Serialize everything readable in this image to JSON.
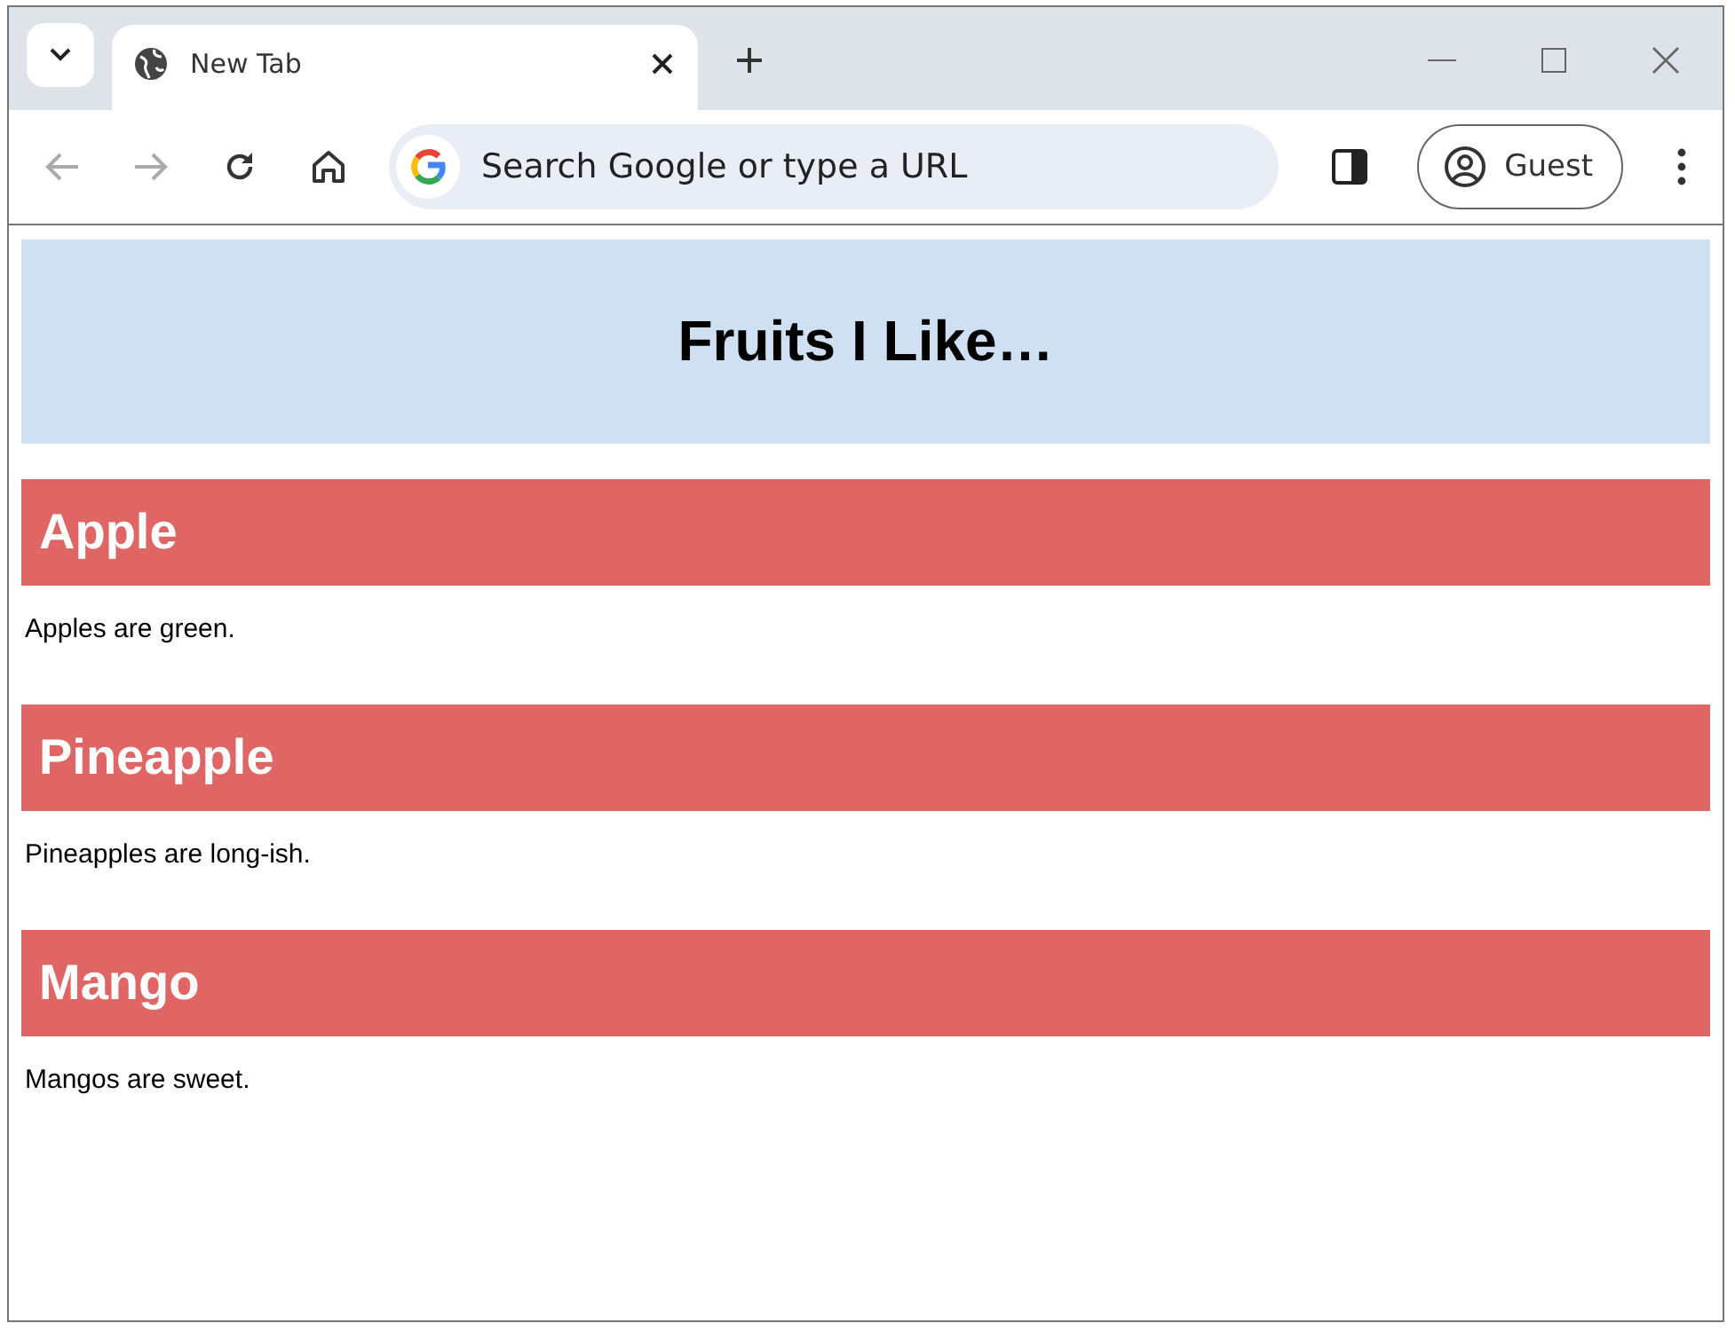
{
  "tabs": [
    {
      "title": "New Tab",
      "selected": true
    }
  ],
  "toolbar": {
    "back_disabled": true,
    "forward_disabled": true
  },
  "omnibox": {
    "placeholder": "Search Google or type a URL"
  },
  "profile": {
    "label": "Guest"
  },
  "page": {
    "title": "Fruits I Like…",
    "sections": [
      {
        "heading": "Apple",
        "text": "Apples are green."
      },
      {
        "heading": "Pineapple",
        "text": "Pineapples are long-ish."
      },
      {
        "heading": "Mango",
        "text": "Mangos are sweet."
      }
    ]
  }
}
